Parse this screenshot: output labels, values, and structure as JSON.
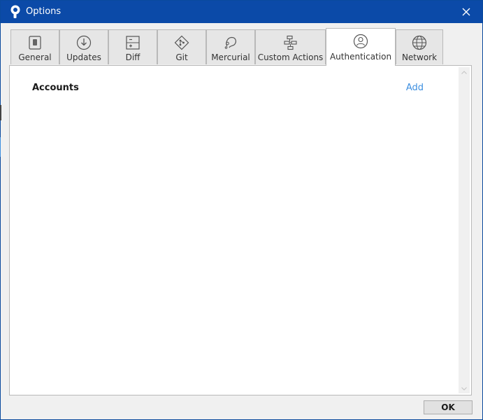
{
  "window": {
    "title": "Options",
    "titlebar_color": "#0b4aa8"
  },
  "icons": {
    "app": "sourcetree-logo-icon",
    "close": "close-icon"
  },
  "tabs": [
    {
      "label": "General",
      "icon": "general-settings-icon"
    },
    {
      "label": "Updates",
      "icon": "download-arrow-icon"
    },
    {
      "label": "Diff",
      "icon": "diff-icon"
    },
    {
      "label": "Git",
      "icon": "git-icon"
    },
    {
      "label": "Mercurial",
      "icon": "mercurial-icon"
    },
    {
      "label": "Custom Actions",
      "icon": "custom-actions-icon"
    },
    {
      "label": "Authentication",
      "icon": "user-account-icon"
    },
    {
      "label": "Network",
      "icon": "globe-icon"
    }
  ],
  "active_tab": "Authentication",
  "panel": {
    "section_title": "Accounts",
    "add_label": "Add",
    "link_color": "#3d8fe0"
  },
  "footer": {
    "ok_label": "OK"
  }
}
